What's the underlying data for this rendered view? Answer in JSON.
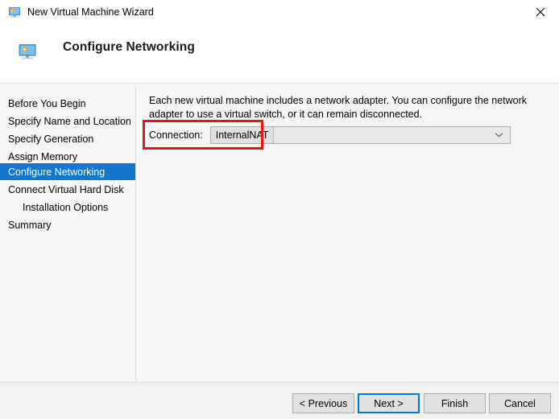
{
  "window": {
    "title": "New Virtual Machine Wizard",
    "title_icon": "virtual-machine-monitor-icon",
    "close_label": "✕"
  },
  "header": {
    "title": "Configure Networking",
    "icon": "virtual-machine-monitor-icon"
  },
  "sidebar": {
    "items": [
      {
        "label": "Before You Begin",
        "active": false,
        "indented": false
      },
      {
        "label": "Specify Name and Location",
        "active": false,
        "indented": false
      },
      {
        "label": "Specify Generation",
        "active": false,
        "indented": false
      },
      {
        "label": "Assign Memory",
        "active": false,
        "indented": false
      },
      {
        "label": "Configure Networking",
        "active": true,
        "indented": false
      },
      {
        "label": "Connect Virtual Hard Disk",
        "active": false,
        "indented": false
      },
      {
        "label": "Installation Options",
        "active": false,
        "indented": true
      },
      {
        "label": "Summary",
        "active": false,
        "indented": false
      }
    ]
  },
  "main": {
    "description": "Each new virtual machine includes a network adapter. You can configure the network adapter to use a virtual switch, or it can remain disconnected.",
    "connection_label": "Connection:",
    "connection_value": "InternalNAT",
    "connection_chevron": "chevron-down-icon"
  },
  "annotation": {
    "color": "#ee1111"
  },
  "footer": {
    "buttons": [
      {
        "label": "< Previous",
        "focused": false
      },
      {
        "label": "Next >",
        "focused": true
      },
      {
        "label": "Finish",
        "focused": false
      },
      {
        "label": "Cancel",
        "focused": false
      }
    ]
  },
  "colors": {
    "accent": "#1477cc",
    "focus": "#0078d7",
    "annotation": "#ee1111",
    "window_bg": "#f6f6f6"
  }
}
